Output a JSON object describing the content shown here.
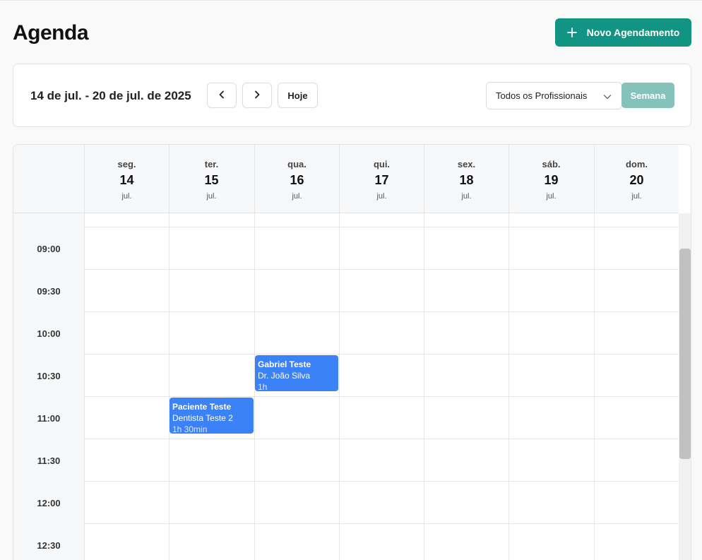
{
  "page": {
    "title": "Agenda",
    "new_button_label": "Novo Agendamento"
  },
  "toolbar": {
    "date_range": "14 de jul. - 20 de jul. de 2025",
    "today_label": "Hoje",
    "professional_filter": "Todos os Profissionais",
    "view_label": "Semana"
  },
  "days": [
    {
      "name": "seg.",
      "number": "14",
      "month": "jul."
    },
    {
      "name": "ter.",
      "number": "15",
      "month": "jul."
    },
    {
      "name": "qua.",
      "number": "16",
      "month": "jul."
    },
    {
      "name": "qui.",
      "number": "17",
      "month": "jul."
    },
    {
      "name": "sex.",
      "number": "18",
      "month": "jul."
    },
    {
      "name": "sáb.",
      "number": "19",
      "month": "jul."
    },
    {
      "name": "dom.",
      "number": "20",
      "month": "jul."
    }
  ],
  "time_slots": [
    "09:00",
    "09:30",
    "10:00",
    "10:30",
    "11:00",
    "11:30",
    "12:00",
    "12:30"
  ],
  "events": [
    {
      "title": "Gabriel Teste",
      "professional": "Dr. João Silva",
      "duration": "1h"
    },
    {
      "title": "Paciente Teste",
      "professional": "Dentista Teste 2",
      "duration": "1h 30min"
    }
  ],
  "colors": {
    "primary": "#129484",
    "primary_muted": "#84c2ba",
    "event": "#3b82f6"
  }
}
